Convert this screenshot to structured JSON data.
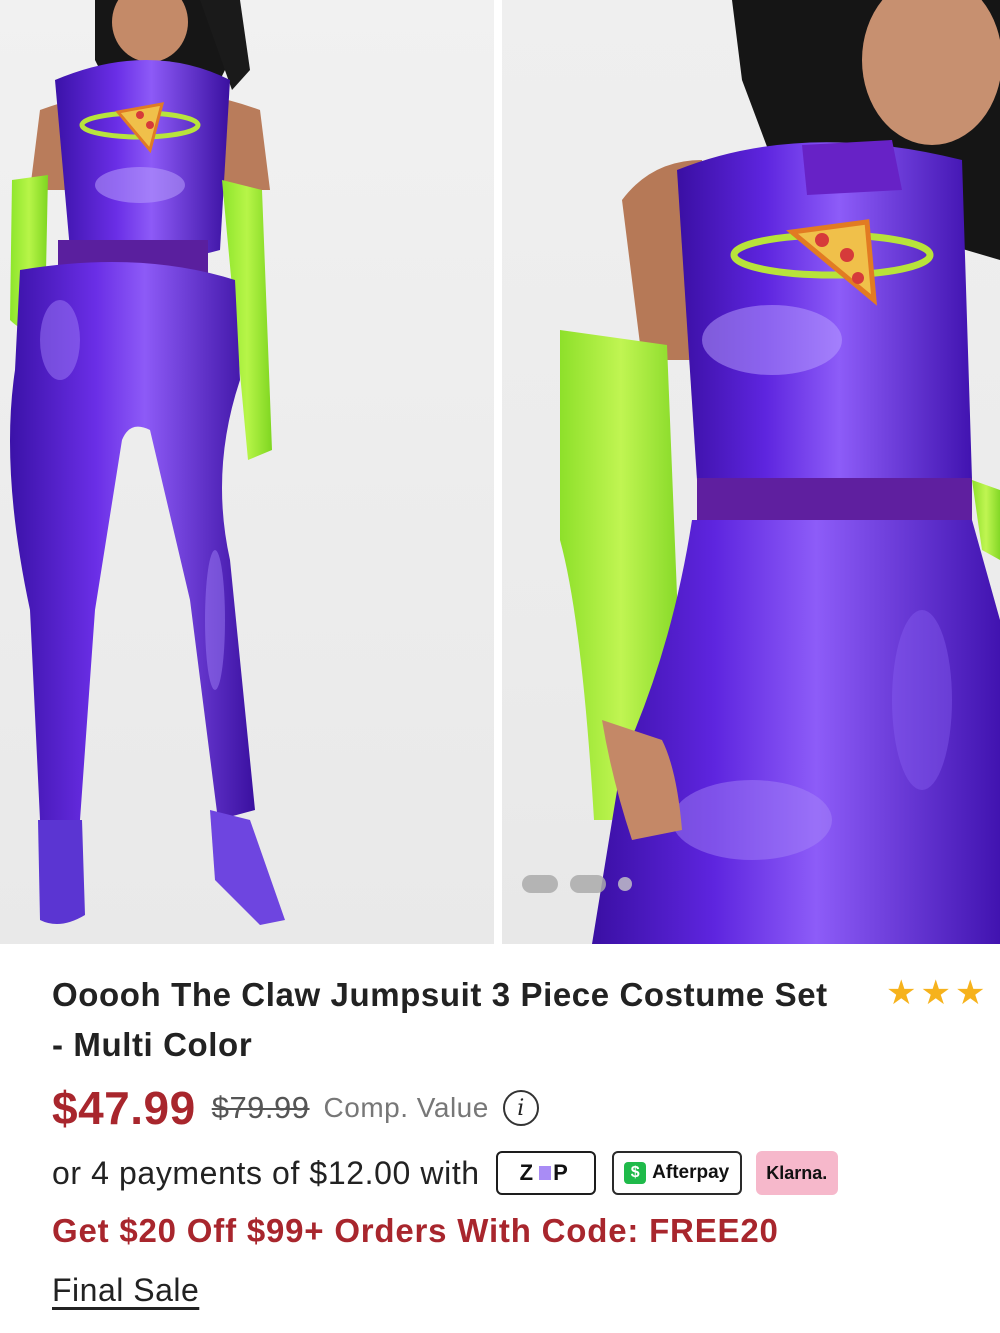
{
  "product": {
    "title": "Ooooh The Claw Jumpsuit 3 Piece Costume Set - Multi Color",
    "rating_stars": [
      "★",
      "★",
      "★"
    ],
    "price_sale": "$47.99",
    "price_original": "$79.99",
    "comp_value_label": "Comp. Value",
    "info_icon_glyph": "i",
    "installment_text": "or 4 payments of $12.00 with",
    "payment_badges": {
      "zip": "Zip",
      "afterpay": "Afterpay",
      "afterpay_icon": "$",
      "klarna": "Klarna."
    },
    "promo_text": "Get $20 Off $99+ Orders With Code: FREE20",
    "final_sale_link": "Final Sale"
  },
  "gallery": {
    "image_count_dots": 3,
    "active_color": "#aaaaaa"
  },
  "colors": {
    "sale_red": "#a8262d",
    "star_gold": "#f6b21c",
    "klarna_pink": "#f6b8cb",
    "afterpay_green": "#1fba4a",
    "zip_purple": "#a98cf5"
  }
}
